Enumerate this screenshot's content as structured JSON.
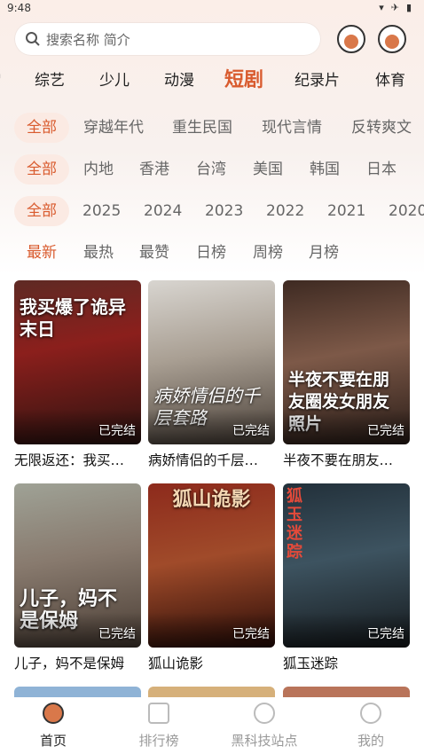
{
  "status_bar": {
    "time": "9:48",
    "icons": [
      "wifi-icon",
      "airplane-icon",
      "battery-icon"
    ]
  },
  "search": {
    "placeholder": "搜索名称 简介"
  },
  "header_buttons": [
    "download-icon",
    "history-icon"
  ],
  "categories": [
    "综艺",
    "少儿",
    "动漫",
    "短剧",
    "纪录片",
    "体育"
  ],
  "active_category": "短剧",
  "filters": {
    "type": [
      "全部",
      "穿越年代",
      "重生民国",
      "现代言情",
      "反转爽文"
    ],
    "region": [
      "全部",
      "内地",
      "香港",
      "台湾",
      "美国",
      "韩国",
      "日本"
    ],
    "year": [
      "全部",
      "2025",
      "2024",
      "2023",
      "2022",
      "2021",
      "2020"
    ],
    "sort": [
      "最新",
      "最热",
      "最赞",
      "日榜",
      "周榜",
      "月榜"
    ]
  },
  "cards": [
    {
      "title": "无限返还：我买…",
      "overlay": "我买爆了诡异末日",
      "status": "已完结"
    },
    {
      "title": "病娇情侣的千层…",
      "overlay": "病娇情侣的千层套路",
      "status": "已完结"
    },
    {
      "title": "半夜不要在朋友…",
      "overlay": "半夜不要在朋友圈发女朋友照片",
      "status": "已完结"
    },
    {
      "title": "儿子，妈不是保姆",
      "overlay": "儿子，妈不是保姆",
      "status": "已完结"
    },
    {
      "title": "狐山诡影",
      "overlay": "狐山诡影",
      "status": "已完结"
    },
    {
      "title": "狐玉迷踪",
      "overlay": "狐玉迷踪",
      "status": "已完结"
    }
  ],
  "tabs": [
    "首页",
    "排行榜",
    "黑科技站点",
    "我的"
  ],
  "active_tab": "首页",
  "colors": {
    "accent": "#d95b2e",
    "chip_bg": "#fbeae3"
  }
}
